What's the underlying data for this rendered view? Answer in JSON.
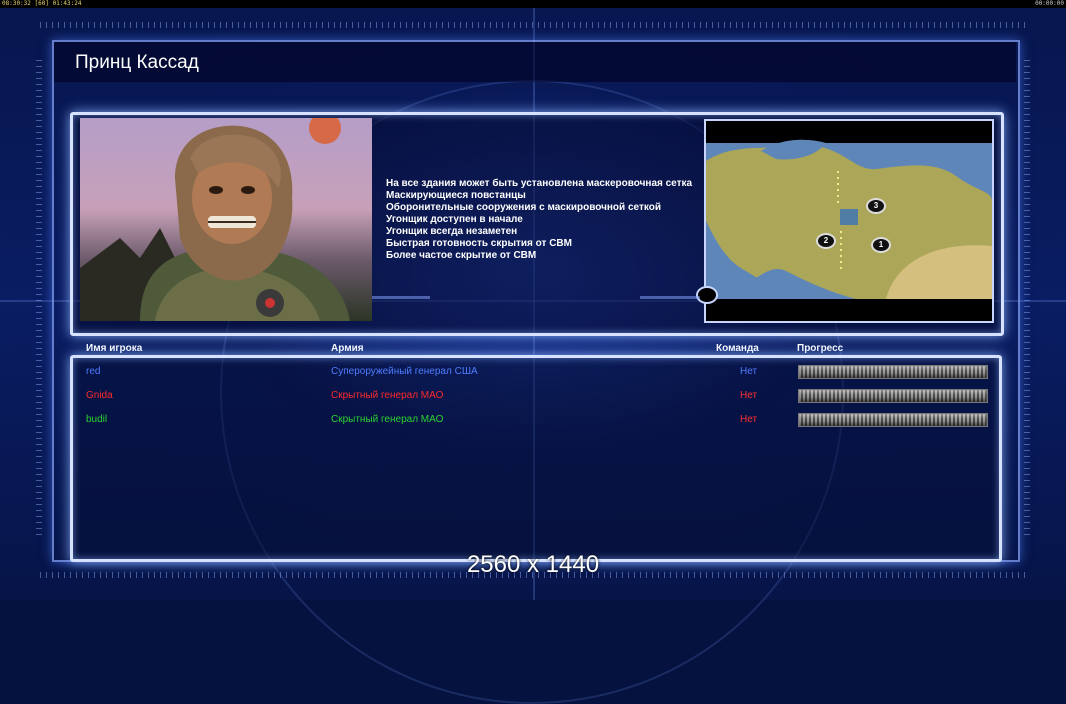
{
  "topbar": {
    "left": "08:30:32 [60] 01:43:24",
    "right": "00:00:00"
  },
  "title": "Принц Кассад",
  "features": [
    "На все здания может быть установлена маскеровочная сетка",
    "Маскирующиеся повстанцы",
    "Оборонительные сооружения с маскировочной сеткой",
    "Угонщик доступен в начале",
    "Угонщик всегда незаметен",
    "Быстрая готовность скрытия от СВМ",
    "Более частое скрытие от СВМ"
  ],
  "minimap": {
    "markers": [
      "1",
      "2",
      "3"
    ]
  },
  "table": {
    "headers": {
      "player": "Имя игрока",
      "army": "Армия",
      "team": "Команда",
      "progress": "Прогресс"
    },
    "rows": [
      {
        "player": "red",
        "army": "Супероружейный генерал США",
        "team": "Нет",
        "progress": 1.0,
        "color": "#4f7cff"
      },
      {
        "player": "Gnida",
        "army": "Скрытный генерал МАО",
        "team": "Нет",
        "progress": 1.0,
        "color": "#ff2a2a"
      },
      {
        "player": "budil",
        "army": "Скрытный генерал МАО",
        "team": "Нет",
        "progress": 1.0,
        "color": "#29d42f"
      }
    ]
  },
  "resolution_label": "2560 x 1440",
  "colors": {
    "team_value": "#ff3030",
    "team_value_first": "#4f7cff"
  }
}
